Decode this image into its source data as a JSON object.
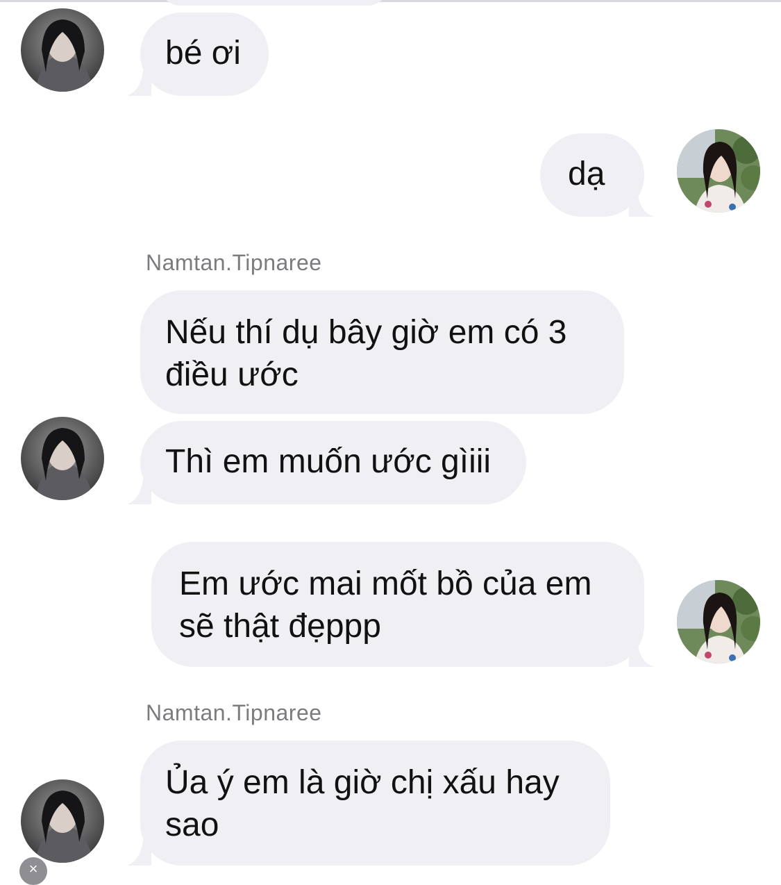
{
  "thread": {
    "sender_name_1": "Namtan.Tipnaree",
    "sender_name_2": "Namtan.Tipnaree",
    "messages": [
      {
        "from": "them",
        "text": "bé ơi"
      },
      {
        "from": "me",
        "text": "dạ"
      },
      {
        "from": "them",
        "text": "Nếu thí dụ bây giờ em có 3 điều ước"
      },
      {
        "from": "them",
        "text": "Thì em muốn ước gìiii"
      },
      {
        "from": "me",
        "text": "Em ước mai mốt bồ của em sẽ thật đẹppp"
      },
      {
        "from": "them",
        "text": "Ủa ý em là giờ chị xấu hay sao"
      }
    ]
  },
  "colors": {
    "bubble": "#efeff4",
    "text": "#111111",
    "sender_name": "#7c7c80",
    "background": "#ffffff"
  },
  "icons": {
    "corner_badge": "close-icon"
  }
}
